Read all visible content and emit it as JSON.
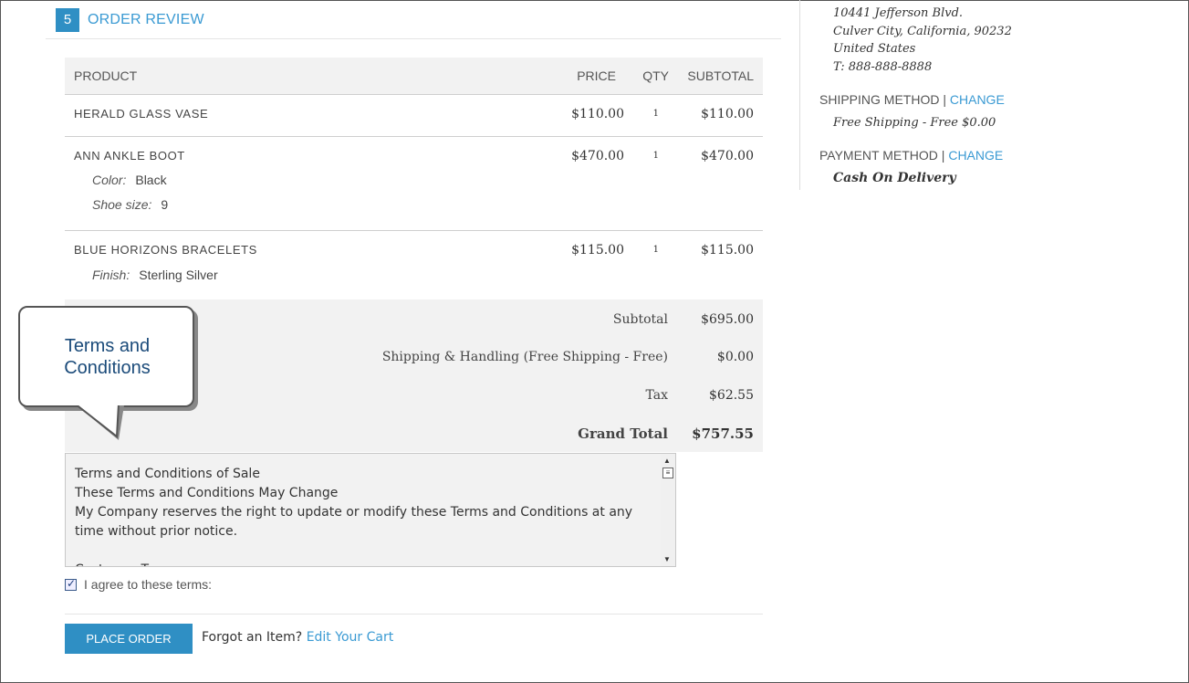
{
  "step": {
    "number": "5",
    "title": "ORDER REVIEW"
  },
  "table": {
    "headers": {
      "product": "PRODUCT",
      "price": "PRICE",
      "qty": "QTY",
      "subtotal": "SUBTOTAL"
    },
    "rows": [
      {
        "name": "HERALD GLASS VASE",
        "price": "$110.00",
        "qty": "1",
        "subtotal": "$110.00",
        "options": []
      },
      {
        "name": "ANN ANKLE BOOT",
        "price": "$470.00",
        "qty": "1",
        "subtotal": "$470.00",
        "options": [
          {
            "label": "Color:",
            "value": "Black"
          },
          {
            "label": "Shoe size:",
            "value": "9"
          }
        ]
      },
      {
        "name": "BLUE HORIZONS BRACELETS",
        "price": "$115.00",
        "qty": "1",
        "subtotal": "$115.00",
        "options": [
          {
            "label": "Finish:",
            "value": "Sterling Silver"
          }
        ]
      }
    ]
  },
  "totals": {
    "subtotal_label": "Subtotal",
    "subtotal_value": "$695.00",
    "shipping_label": "Shipping & Handling (Free Shipping - Free)",
    "shipping_value": "$0.00",
    "tax_label": "Tax",
    "tax_value": "$62.55",
    "grand_label": "Grand Total",
    "grand_value": "$757.55"
  },
  "terms": {
    "text": "Terms and Conditions of Sale\nThese Terms and Conditions May Change\nMy Company reserves the right to update or modify these Terms and Conditions at any time without prior notice.\n\nCustomer Terms"
  },
  "agree_label": "I agree to these terms:",
  "agree_checked": true,
  "place_order_label": "PLACE ORDER",
  "forgot": {
    "text": "Forgot an Item?",
    "link": "Edit Your Cart"
  },
  "callout": {
    "line1": "Terms and",
    "line2": "Conditions"
  },
  "sidebar": {
    "address": [
      "10441 Jefferson Blvd.",
      "Culver City, California, 90232",
      "United States",
      "T: 888-888-8888"
    ],
    "shipping_heading": "SHIPPING METHOD",
    "shipping_change": "CHANGE",
    "shipping_value": "Free Shipping - Free $0.00",
    "payment_heading": "PAYMENT METHOD",
    "payment_change": "CHANGE",
    "payment_value": "Cash On Delivery"
  },
  "colors": {
    "accent": "#2f8fc4",
    "link": "#3a9ad3",
    "table_bg": "#f2f2f2"
  }
}
